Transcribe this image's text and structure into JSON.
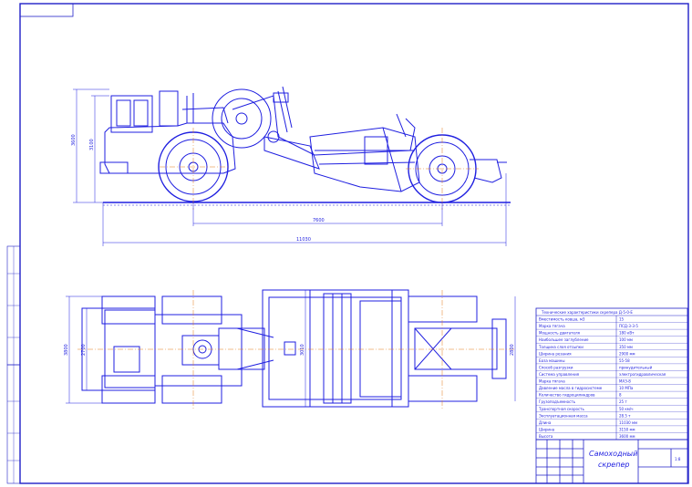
{
  "drawing": {
    "title_line1": "Самоходный",
    "title_line2": "скрепер",
    "sheet_mark": "1:8"
  },
  "side_view": {
    "dim_length_total": "11030",
    "dim_wheelbase": "7600",
    "dim_height_total": "3600",
    "dim_height_2": "3100"
  },
  "plan_view": {
    "dim_width_left": "3800",
    "dim_width_inner": "2700",
    "dim_bowl_width": "3010",
    "dim_right": "2800"
  },
  "spec_table": {
    "heading": "Технические характеристики скрепера Д-5-0-Е",
    "rows": [
      {
        "label": "Вместимость ковша, м3",
        "value": "15"
      },
      {
        "label": "Марка тягача",
        "value": "ПСД-3-3-5"
      },
      {
        "label": "Мощность двигателя",
        "value": "180 кВт"
      },
      {
        "label": "Наибольшее заглубление",
        "value": "100 мм"
      },
      {
        "label": "Толщина слоя отсыпки",
        "value": "350 мм"
      },
      {
        "label": "Ширина резания",
        "value": "2900 мм"
      },
      {
        "label": "База машины",
        "value": "55-58"
      },
      {
        "label": "Способ разгрузки",
        "value": "принудительный"
      },
      {
        "label": "Система управления",
        "value": "электрогидравлическая"
      },
      {
        "label": "Марка тягача",
        "value": "МАЗ-8"
      },
      {
        "label": "Давление масла в гидросистеме",
        "value": "10 МПа"
      },
      {
        "label": "Количество гидроцилиндров",
        "value": "8"
      },
      {
        "label": "Грузоподъемность",
        "value": "25 т"
      },
      {
        "label": "Транспортная скорость",
        "value": "50 км/ч"
      },
      {
        "label": "Эксплуатационная масса",
        "value": "28.5 т"
      },
      {
        "label": "Длина",
        "value": "11030 мм"
      },
      {
        "label": "Ширина",
        "value": "3150 мм"
      },
      {
        "label": "Высота",
        "value": "3600 мм"
      }
    ]
  },
  "colors": {
    "line": "#1f1fe0",
    "axis": "#e07a1a",
    "frame": "#2020c8"
  }
}
